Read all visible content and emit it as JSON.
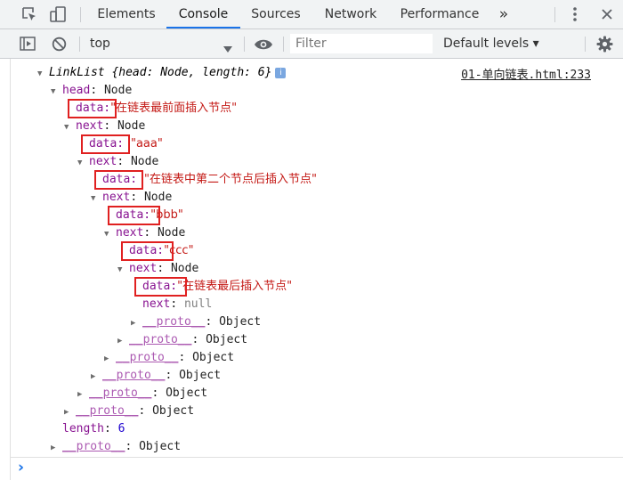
{
  "tabs": {
    "elements": "Elements",
    "console": "Console",
    "sources": "Sources",
    "network": "Network",
    "performance": "Performance",
    "more": "»"
  },
  "toolbar": {
    "context": "top",
    "filter_placeholder": "Filter",
    "levels": "Default levels ▾"
  },
  "source_link": "01-单向链表.html:233",
  "tree": {
    "root": "LinkList {head: Node, length: 6}",
    "info_icon": "i",
    "head_key": "head",
    "node": "Node",
    "next_key": "next",
    "data_key": "data:",
    "d1": "\"在链表最前面插入节点\"",
    "d2": "\"aaa\"",
    "d3": "\"在链表中第二个节点后插入节点\"",
    "d4": "\"bbb\"",
    "d5": "\"ccc\"",
    "d6": "\"在链表最后插入节点\"",
    "null_val": "null",
    "proto_key": "__proto__",
    "object": ": Object",
    "length_key": "length",
    "length_val": "6"
  },
  "prompt_symbol": "›"
}
